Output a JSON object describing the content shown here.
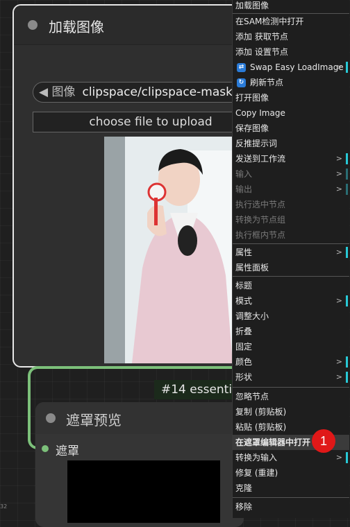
{
  "load_node": {
    "title": "加载图像",
    "image_label": "◀ 图像",
    "image_value": "clipspace/clipspace-mask-",
    "upload_label": "choose file to upload"
  },
  "group": {
    "title": "#14 essential"
  },
  "mask_node": {
    "title": "遮罩预览",
    "slot_label": "遮罩"
  },
  "context_menu": {
    "items": [
      {
        "label": "加载图像",
        "state": "normal"
      },
      {
        "label": "在SAM检测中打开",
        "state": "normal"
      },
      {
        "label": "添加 获取节点",
        "state": "normal"
      },
      {
        "label": "添加 设置节点",
        "state": "normal"
      },
      {
        "label": "Swap Easy LoadImage",
        "state": "normal",
        "submenu": true,
        "icon": "swap-icon"
      },
      {
        "label": "刷新节点",
        "state": "normal",
        "icon": "refresh-icon"
      },
      {
        "label": "打开图像",
        "state": "normal"
      },
      {
        "label": "Copy Image",
        "state": "normal"
      },
      {
        "label": "保存图像",
        "state": "normal"
      },
      {
        "label": "反推提示词",
        "state": "normal"
      },
      {
        "label": "发送到工作流",
        "state": "normal",
        "submenu": true
      },
      {
        "label": "输入",
        "state": "disabled",
        "submenu": true
      },
      {
        "label": "输出",
        "state": "disabled",
        "submenu": true
      },
      {
        "label": "执行选中节点",
        "state": "disabled"
      },
      {
        "label": "转换为节点组",
        "state": "disabled"
      },
      {
        "label": "执行框内节点",
        "state": "disabled"
      },
      {
        "label": "属性",
        "state": "normal",
        "submenu": true
      },
      {
        "label": "属性面板",
        "state": "normal"
      },
      {
        "label": "标题",
        "state": "normal"
      },
      {
        "label": "模式",
        "state": "normal",
        "submenu": true
      },
      {
        "label": "调整大小",
        "state": "normal"
      },
      {
        "label": "折叠",
        "state": "normal"
      },
      {
        "label": "固定",
        "state": "normal"
      },
      {
        "label": "颜色",
        "state": "normal",
        "submenu": true
      },
      {
        "label": "形状",
        "state": "normal",
        "submenu": true
      },
      {
        "label": "忽略节点",
        "state": "normal"
      },
      {
        "label": "复制 (剪贴板)",
        "state": "normal"
      },
      {
        "label": "粘贴 (剪贴板)",
        "state": "normal"
      },
      {
        "label": "在遮罩编辑器中打开",
        "state": "highlight"
      },
      {
        "label": "转换为输入",
        "state": "normal",
        "submenu": true
      },
      {
        "label": "修复 (重建)",
        "state": "normal"
      },
      {
        "label": "克隆",
        "state": "normal"
      },
      {
        "label": "移除",
        "state": "normal"
      }
    ]
  },
  "annotation": {
    "badge": "1"
  },
  "canvas": {
    "corner_text": "32"
  }
}
